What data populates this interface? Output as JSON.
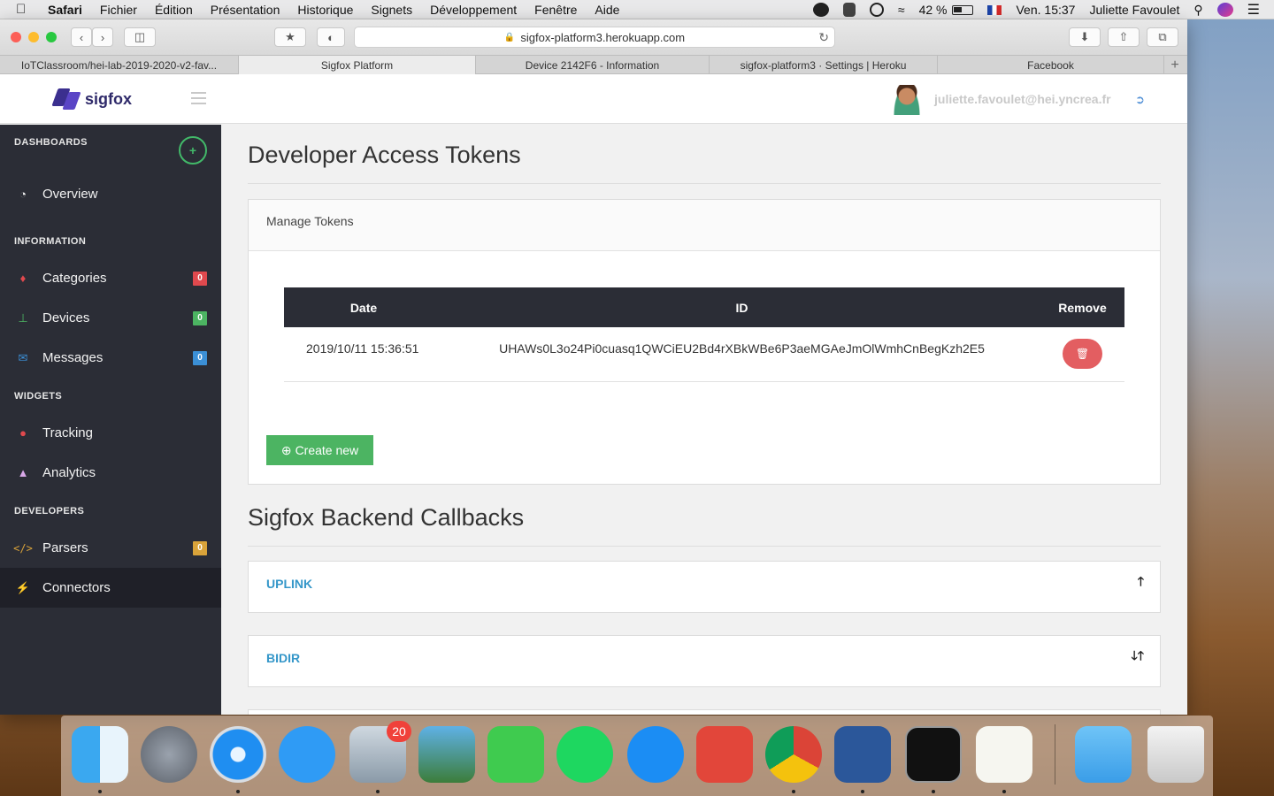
{
  "menubar": {
    "apple": "",
    "items": [
      "Safari",
      "Fichier",
      "Édition",
      "Présentation",
      "Historique",
      "Signets",
      "Développement",
      "Fenêtre",
      "Aide"
    ],
    "battery": "42 %",
    "clock": "Ven. 15:37",
    "user": "Juliette Favoulet"
  },
  "browser": {
    "url": "sigfox-platform3.herokuapp.com",
    "tabs": [
      "IoTClassroom/hei-lab-2019-2020-v2-fav...",
      "Sigfox Platform",
      "Device 2142F6 - Information",
      "sigfox-platform3 · Settings | Heroku",
      "Facebook"
    ],
    "new_tab": "+"
  },
  "topnav": {
    "logo_text": "sigfox",
    "user_email": "juliette.favoulet@hei.yncrea.fr"
  },
  "sidebar": {
    "sections": {
      "dashboards": "DASHBOARDS",
      "information": "INFORMATION",
      "widgets": "WIDGETS",
      "developers": "DEVELOPERS"
    },
    "items": {
      "overview": "Overview",
      "categories": {
        "label": "Categories",
        "count": "0",
        "color": "#e0494e"
      },
      "devices": {
        "label": "Devices",
        "count": "0",
        "color": "#4cb462"
      },
      "messages": {
        "label": "Messages",
        "count": "0",
        "color": "#3b8fd6"
      },
      "tracking": "Tracking",
      "analytics": "Analytics",
      "parsers": {
        "label": "Parsers",
        "count": "0",
        "color": "#d9a33a"
      },
      "connectors": "Connectors"
    }
  },
  "main": {
    "tokens_title": "Developer Access Tokens",
    "panel_title": "Manage Tokens",
    "table": {
      "headers": [
        "Date",
        "ID",
        "Remove"
      ],
      "rows": [
        {
          "date": "2019/10/11 15:36:51",
          "id": "UHAWs0L3o24Pi0cuasq1QWCiEU2Bd4rXBkWBe6P3aeMGAeJmOlWmhCnBegKzh2E5"
        }
      ]
    },
    "create_label": "Create new",
    "callbacks_title": "Sigfox Backend Callbacks",
    "callbacks": [
      {
        "title": "UPLINK",
        "arrows": "🡑"
      },
      {
        "title": "BIDIR",
        "arrows": "🡓🡑"
      }
    ]
  },
  "dock": {
    "mail_badge": "20"
  }
}
